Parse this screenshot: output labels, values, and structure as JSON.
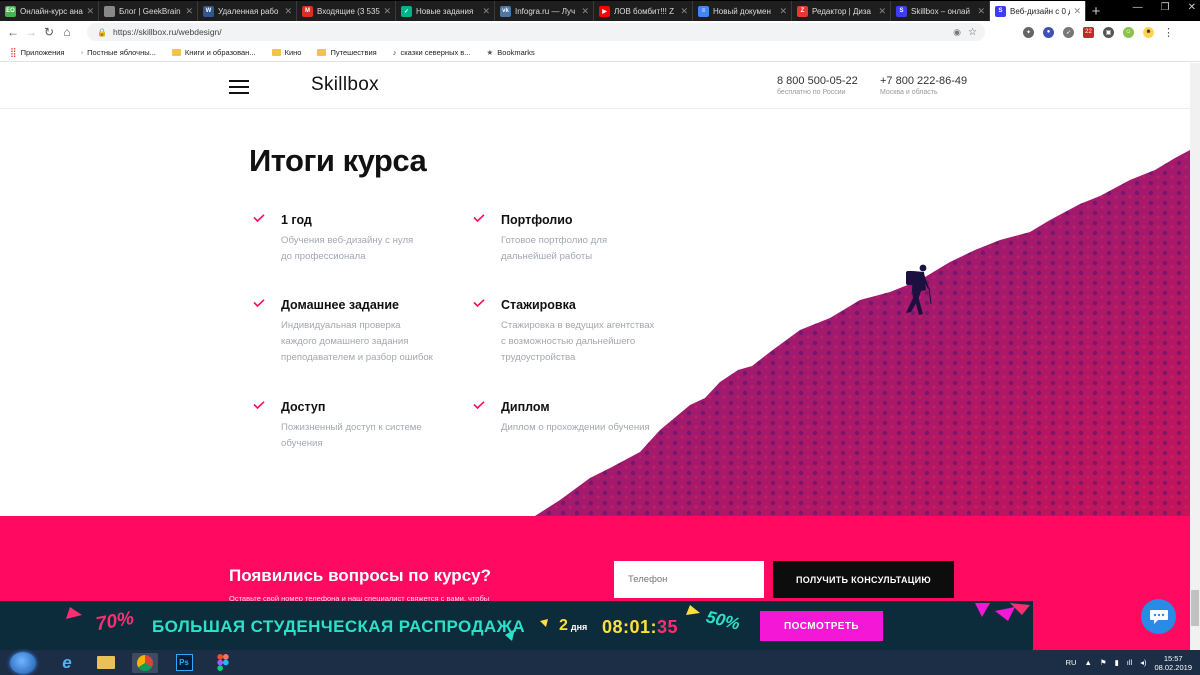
{
  "browser": {
    "tabs": [
      {
        "label": "Онлайн-курс ана",
        "icon": "eo-icon",
        "icon_text": "EO",
        "color": "#4caf50"
      },
      {
        "label": "Блог | GeekBrain",
        "icon": "geekbrains-icon",
        "icon_text": "",
        "color": "#888888"
      },
      {
        "label": "Удаленная рабо",
        "icon": "word-icon",
        "icon_text": "W",
        "color": "#2b5797"
      },
      {
        "label": "Входящие (3 535",
        "icon": "gmail-icon",
        "icon_text": "M",
        "color": "#d93025"
      },
      {
        "label": "Новые задания",
        "icon": "check-icon",
        "icon_text": "✓",
        "color": "#00b488"
      },
      {
        "label": "Infogra.ru — Луч",
        "icon": "vk-icon",
        "icon_text": "vk",
        "color": "#4a76a8"
      },
      {
        "label": "ЛОВ бомбит!!! Z",
        "icon": "youtube-icon",
        "icon_text": "▶",
        "color": "#ff0000"
      },
      {
        "label": "Новый докумен",
        "icon": "docs-icon",
        "icon_text": "≡",
        "color": "#4285f4"
      },
      {
        "label": "Редактор | Диза",
        "icon": "zen-icon",
        "icon_text": "Z",
        "color": "#e53935"
      },
      {
        "label": "Skillbox – онлай",
        "icon": "skillbox-icon",
        "icon_text": "S",
        "color": "#3d3df5"
      },
      {
        "label": "Веб-дизайн с 0 д",
        "icon": "skillbox-icon",
        "icon_text": "S",
        "color": "#3d3df5",
        "active": true
      }
    ],
    "new_tab": "+",
    "url": "https://skillbox.ru/webdesign/",
    "bookmarks": [
      {
        "label": "Приложения",
        "icon": "apps-icon"
      },
      {
        "label": "Постные яблочны...",
        "icon": "page-icon"
      },
      {
        "label": "Книги и образован...",
        "icon": "folder-icon"
      },
      {
        "label": "Кино",
        "icon": "folder-icon"
      },
      {
        "label": "Путешествия",
        "icon": "folder-icon"
      },
      {
        "label": "сказки северных в...",
        "icon": "audio-icon"
      },
      {
        "label": "Bookmarks",
        "icon": "star-icon"
      }
    ],
    "ext_badge": "22"
  },
  "site": {
    "logo": "Skillbox",
    "phones": [
      {
        "number": "8 800 500-05-22",
        "caption": "бесплатно по России"
      },
      {
        "number": "+7 800 222-86-49",
        "caption": "Москва и область"
      }
    ]
  },
  "results": {
    "title": "Итоги курса",
    "items": [
      {
        "title": "1 год",
        "lines": [
          "Обучения веб-дизайну с нуля",
          "до профессионала"
        ]
      },
      {
        "title": "Портфолио",
        "lines": [
          "Готовое портфолио для",
          "дальнейшей работы"
        ]
      },
      {
        "title": "Домашнее задание",
        "lines": [
          "Индивидуальная проверка",
          "каждого домашнего задания",
          "преподавателем и разбор ошибок"
        ]
      },
      {
        "title": "Стажировка",
        "lines": [
          "Стажировка в ведущих агентствах",
          "с возможностью дальнейшего",
          "трудоустройства"
        ]
      },
      {
        "title": "Доступ",
        "lines": [
          "Пожизненный доступ к системе",
          "обучения"
        ]
      },
      {
        "title": "Диплом",
        "lines": [
          "Диплом о прохождении обучения"
        ]
      }
    ],
    "accent": "#ff0a60"
  },
  "consult": {
    "title": "Появились вопросы по курсу?",
    "subtitle": "Оставьте свой номер телефона и наш специалист свяжется с вами, чтобы",
    "phone_placeholder": "Телефон",
    "button": "ПОЛУЧИТЬ КОНСУЛЬТАЦИЮ"
  },
  "sale": {
    "badge_left": "70%",
    "text": "БОЛЬШАЯ СТУДЕНЧЕСКАЯ РАСПРОДАЖА",
    "days_num": "2",
    "days_word": "дня",
    "time_hm": "08:01:",
    "time_s": "35",
    "badge_right": "50%",
    "button": "ПОСМОТРЕТЬ"
  },
  "taskbar": {
    "lang": "RU",
    "time": "15:57",
    "date": "08.02.2019",
    "apps": [
      "ie-icon",
      "explorer-icon",
      "chrome-icon",
      "photoshop-icon",
      "figma-icon"
    ]
  }
}
